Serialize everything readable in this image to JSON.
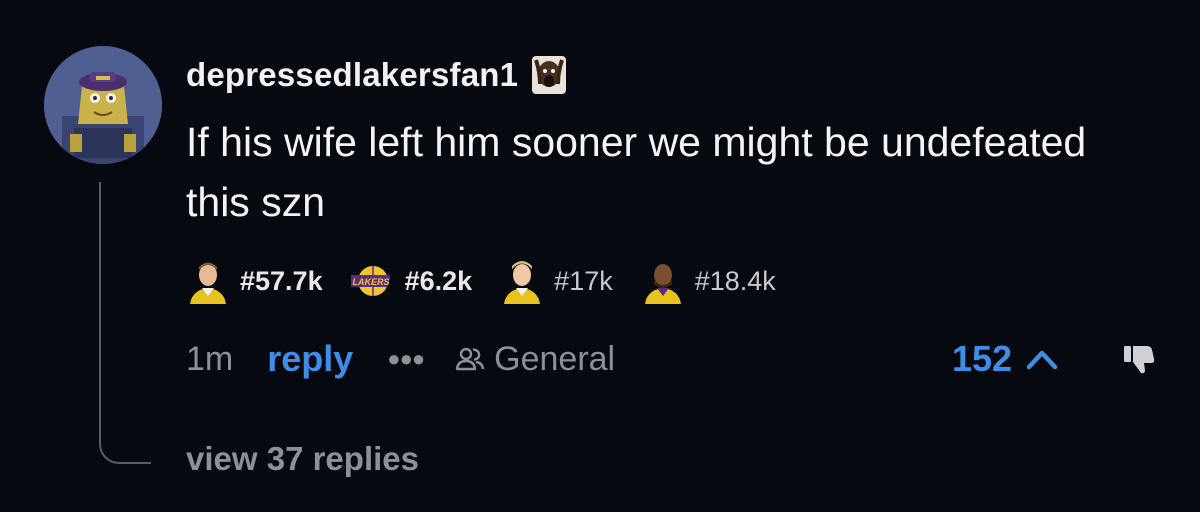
{
  "comment": {
    "username": "depressedlakersfan1",
    "username_emoji": "screaming-face-emoji",
    "avatar": "spongebob-avatar",
    "text": "If his wife left him sooner we might be undefeated this szn"
  },
  "flairs": [
    {
      "icon": "player-headshot-icon",
      "label": "#57.7k",
      "weight": "bold"
    },
    {
      "icon": "lakers-logo-icon",
      "label": "#6.2k",
      "weight": "bold"
    },
    {
      "icon": "player-headshot-icon",
      "label": "#17k",
      "weight": "normal"
    },
    {
      "icon": "player-headshot-icon",
      "label": "#18.4k",
      "weight": "normal"
    }
  ],
  "actions": {
    "time": "1m",
    "reply_label": "reply",
    "more_label": "●●●",
    "channel_icon": "users-icon",
    "channel": "General",
    "votes": "152",
    "upvote_icon": "chevron-up-icon",
    "downvote_icon": "thumbs-down-icon"
  },
  "footer": {
    "view_replies": "view 37 replies"
  },
  "colors": {
    "background": "#06090f",
    "accent": "#3e8ee8",
    "muted": "#8e9098",
    "text": "#f4f4f6"
  }
}
